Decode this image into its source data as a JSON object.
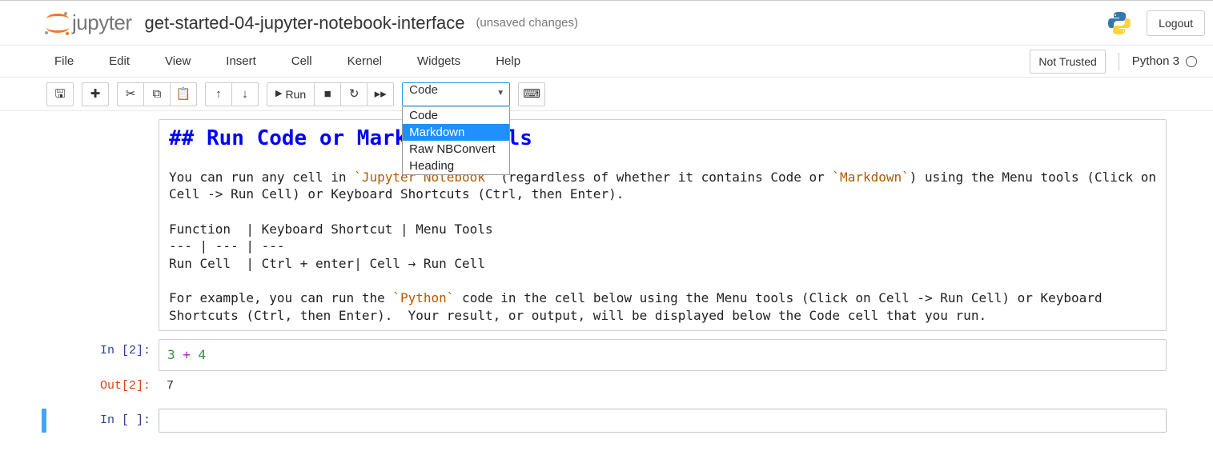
{
  "header": {
    "logo_text": "jupyter",
    "title": "get-started-04-jupyter-notebook-interface",
    "status": "(unsaved changes)",
    "logout_label": "Logout"
  },
  "menubar": {
    "items": [
      "File",
      "Edit",
      "View",
      "Insert",
      "Cell",
      "Kernel",
      "Widgets",
      "Help"
    ],
    "not_trusted": "Not Trusted",
    "kernel": "Python 3"
  },
  "toolbar": {
    "run_label": "Run",
    "cell_type_selected": "Code",
    "cell_type_options": [
      "Code",
      "Markdown",
      "Raw NBConvert",
      "Heading"
    ],
    "highlighted_index": 1
  },
  "cells": {
    "markdown": {
      "heading": "## Run Code or Markdown Cells",
      "body1_a": "You can run any cell in ",
      "body1_jn": "`Jupyter Notebook`",
      "body1_b": " (regardless of whether it contains Code or ",
      "body1_md": "`Markdown`",
      "body1_c": ") using the Menu tools (Click on Cell -> Run Cell) or Keyboard Shortcuts (Ctrl, then Enter).",
      "table_h": "Function  | Keyboard Shortcut | Menu Tools",
      "table_sep": "--- | --- | ---",
      "table_row": "Run Cell  | Ctrl + enter| Cell → Run Cell",
      "body2_a": "For example, you can run the ",
      "body2_py": "`Python`",
      "body2_b": " code in the cell below using the Menu tools (Click on Cell -> Run Cell) or Keyboard Shortcuts (Ctrl, then Enter).  Your result, or output, will be displayed below the Code cell that you run."
    },
    "code1": {
      "prompt": "In [2]:",
      "src_a": "3",
      "src_op": " + ",
      "src_b": "4"
    },
    "out1": {
      "prompt": "Out[2]:",
      "value": "7"
    },
    "code2": {
      "prompt": "In [ ]:"
    }
  }
}
